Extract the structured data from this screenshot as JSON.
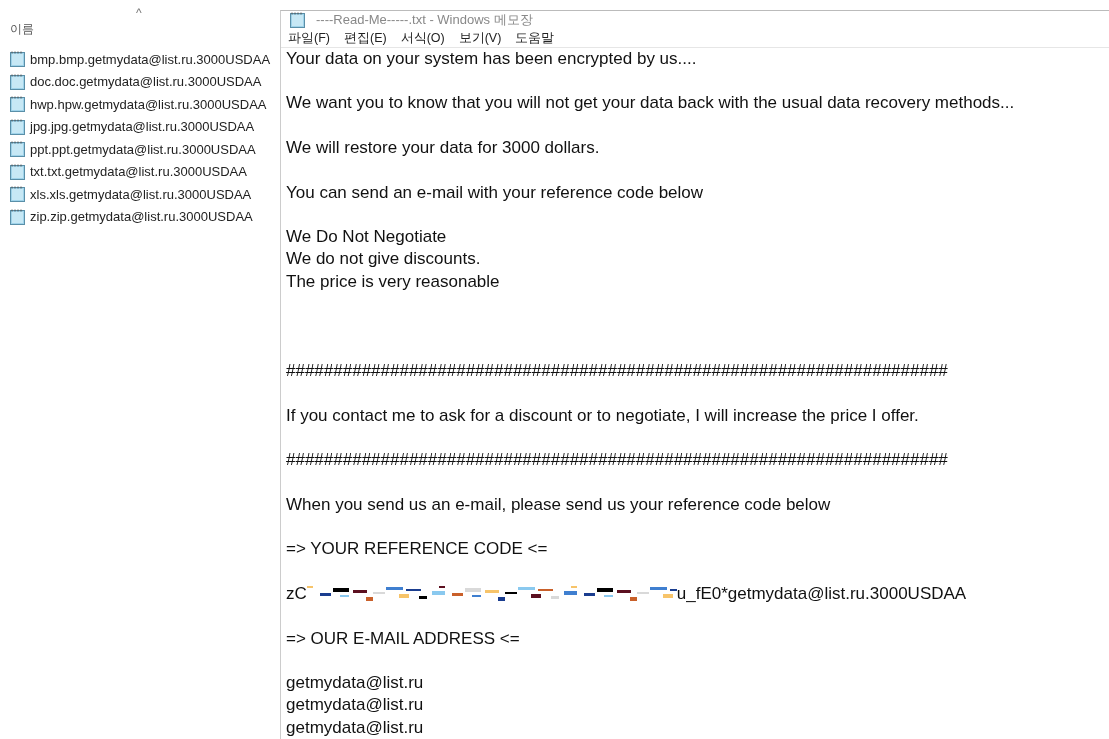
{
  "explorer": {
    "column_header": "이름",
    "sort_indicator": "^",
    "files": [
      {
        "name": "bmp.bmp.getmydata@list.ru.3000USDAA"
      },
      {
        "name": "doc.doc.getmydata@list.ru.3000USDAA"
      },
      {
        "name": "hwp.hpw.getmydata@list.ru.3000USDAA"
      },
      {
        "name": "jpg.jpg.getmydata@list.ru.3000USDAA"
      },
      {
        "name": "ppt.ppt.getmydata@list.ru.3000USDAA"
      },
      {
        "name": "txt.txt.getmydata@list.ru.3000USDAA"
      },
      {
        "name": "xls.xls.getmydata@list.ru.3000USDAA"
      },
      {
        "name": "zip.zip.getmydata@list.ru.3000USDAA"
      }
    ]
  },
  "notepad": {
    "title": "----Read-Me-----.txt - Windows 메모장",
    "menu": [
      "파일(F)",
      "편집(E)",
      "서식(O)",
      "보기(V)",
      "도움말"
    ],
    "sections": [
      {
        "blocks": [
          {
            "kind": "text",
            "lines": [
              "Your data on your system has been encrypted by us...."
            ]
          },
          {
            "kind": "text",
            "lines": [
              "We want you to know that you will not get your data back with the usual data recovery methods..."
            ]
          },
          {
            "kind": "text",
            "lines": [
              "We will restore your data for 3000 dollars."
            ]
          },
          {
            "kind": "text",
            "lines": [
              "You can send an e-mail with your reference code below"
            ]
          },
          {
            "kind": "text",
            "lines": [
              "We Do Not Negotiate",
              "We do not give discounts.",
              "The price is very reasonable"
            ]
          }
        ]
      },
      {
        "blocks": [
          {
            "kind": "text",
            "lines": [
              "######################################################################"
            ]
          },
          {
            "kind": "text",
            "lines": [
              "If you contact me to ask for a discount or to negotiate, I will increase the price I offer."
            ]
          },
          {
            "kind": "text",
            "lines": [
              "######################################################################"
            ]
          },
          {
            "kind": "text",
            "lines": [
              "When you send us an e-mail, please send us your reference code below"
            ]
          },
          {
            "kind": "text",
            "lines": [
              "=> YOUR REFERENCE CODE <="
            ]
          },
          {
            "kind": "code",
            "prefix": "zC",
            "suffix": "u_fE0*getmydata@list.ru.3000USDAA"
          },
          {
            "kind": "text",
            "lines": [
              "=> OUR E-MAIL ADDRESS <="
            ]
          },
          {
            "kind": "text",
            "lines": [
              "getmydata@list.ru",
              "getmydata@list.ru",
              "getmydata@list.ru"
            ]
          }
        ]
      }
    ]
  }
}
